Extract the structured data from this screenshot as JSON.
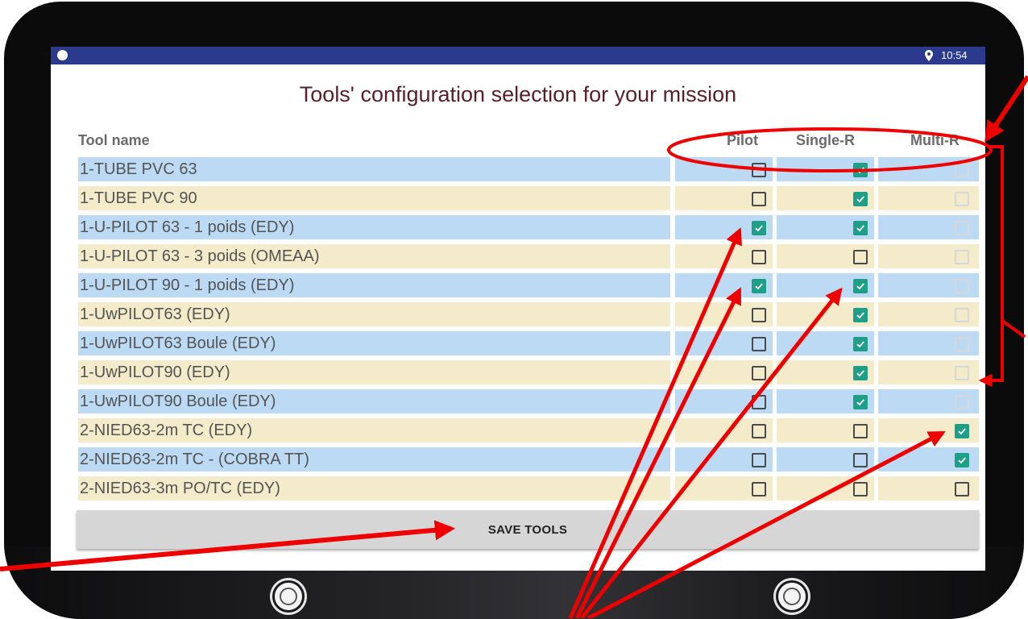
{
  "status_bar": {
    "time": "10:54",
    "icons": [
      "circle-indicator-icon",
      "location-pin-icon"
    ]
  },
  "page": {
    "title": "Tools' configuration selection for your mission"
  },
  "table": {
    "headers": {
      "name": "Tool name",
      "pilot": "Pilot",
      "single": "Single-R",
      "multi": "Multi-R"
    },
    "rows": [
      {
        "name": "1-TUBE PVC 63",
        "pilot": false,
        "single": true,
        "multi": false,
        "multi_enabled": false
      },
      {
        "name": "1-TUBE PVC 90",
        "pilot": false,
        "single": true,
        "multi": false,
        "multi_enabled": false
      },
      {
        "name": "1-U-PILOT 63 - 1 poids (EDY)",
        "pilot": true,
        "single": true,
        "multi": false,
        "multi_enabled": false
      },
      {
        "name": "1-U-PILOT 63 - 3 poids (OMEAA)",
        "pilot": false,
        "single": false,
        "multi": false,
        "multi_enabled": false
      },
      {
        "name": "1-U-PILOT 90 - 1 poids (EDY)",
        "pilot": true,
        "single": true,
        "multi": false,
        "multi_enabled": false
      },
      {
        "name": "1-UwPILOT63 (EDY)",
        "pilot": false,
        "single": true,
        "multi": false,
        "multi_enabled": false
      },
      {
        "name": "1-UwPILOT63 Boule (EDY)",
        "pilot": false,
        "single": true,
        "multi": false,
        "multi_enabled": false
      },
      {
        "name": "1-UwPILOT90 (EDY)",
        "pilot": false,
        "single": true,
        "multi": false,
        "multi_enabled": false
      },
      {
        "name": "1-UwPILOT90 Boule (EDY)",
        "pilot": false,
        "single": true,
        "multi": false,
        "multi_enabled": false
      },
      {
        "name": "2-NIED63-2m TC (EDY)",
        "pilot": false,
        "single": false,
        "multi": true,
        "multi_enabled": true
      },
      {
        "name": "2-NIED63-2m TC - (COBRA TT)",
        "pilot": false,
        "single": false,
        "multi": true,
        "multi_enabled": true
      },
      {
        "name": "2-NIED63-3m PO/TC (EDY)",
        "pilot": false,
        "single": false,
        "multi": false,
        "multi_enabled": true
      }
    ]
  },
  "buttons": {
    "save": "SAVE TOOLS"
  },
  "colors": {
    "status_bar": "#2b3a8d",
    "title": "#5a1d2e",
    "row_blue": "#bcdaf4",
    "row_beige": "#f3ebc9",
    "checkbox_checked": "#1f9e88",
    "annotation": "#ee0000"
  }
}
